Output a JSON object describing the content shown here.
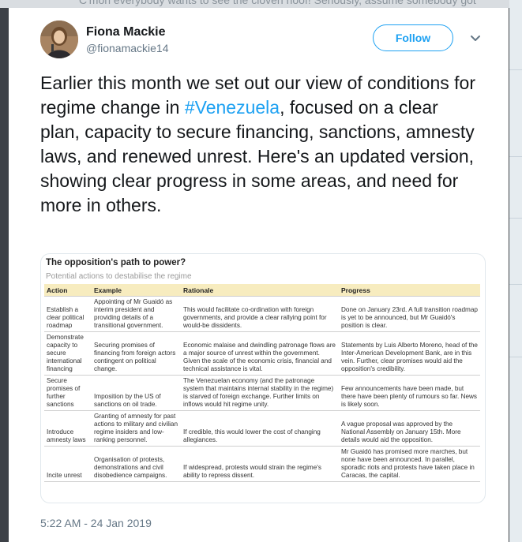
{
  "background_tweet": {
    "text": "C'mon everybody wants to see the cloven hoof! Seriously, assume somebody got"
  },
  "author": {
    "name": "Fiona Mackie",
    "handle": "@fionamackie14"
  },
  "follow_label": "Follow",
  "tweet": {
    "text_before": "Earlier this month we set out our view of conditions for regime change in ",
    "hashtag": "#Venezuela",
    "text_after": ", focused on a clear plan, capacity to secure financing, sanctions, amnesty laws, and renewed unrest. Here's an updated version, showing clear progress in some areas, and need for more in others."
  },
  "table": {
    "title": "The opposition's path to power?",
    "subtitle": "Potential actions to destabilise the regime",
    "headers": [
      "Action",
      "Example",
      "Rationale",
      "Progress"
    ],
    "rows": [
      {
        "action": "Establish a clear political roadmap",
        "example": "Appointing of Mr Guaidó as interim president and providing details of a transitional government.",
        "rationale": "This would facilitate co-ordination with foreign governments, and provide a clear rallying point for would-be dissidents.",
        "progress": "Done on January 23rd. A full transition roadmap is yet to be announced, but Mr Guaidó's position is clear."
      },
      {
        "action": "Demonstrate capacity to secure international financing",
        "example": "Securing promises of financing from foreign actors contingent on political change.",
        "rationale": "Economic malaise and dwindling patronage flows are a major source of unrest within the government. Given the scale of the economic crisis, financial and technical assistance is vital.",
        "progress": "Statements by Luis Alberto Moreno, head of the Inter-American Development Bank, are in this vein. Further, clear promises would aid the opposition's credibility."
      },
      {
        "action": "Secure promises of further sanctions",
        "example": "Imposition by the US of sanctions on oil trade.",
        "rationale": "The Venezuelan economy (and the patronage system that maintains internal stability in the regime) is starved of foreign exchange. Further limits on inflows would hit regime unity.",
        "progress": "Few announcements have been made, but there have been plenty of rumours so far. News is likely soon."
      },
      {
        "action": "Introduce amnesty laws",
        "example": "Granting of amnesty for past actions to military and civilian regime insiders and low-ranking personnel.",
        "rationale": "If credible, this would lower the cost of changing allegiances.",
        "progress": "A vague proposal was approved by the National Assembly on January 15th. More details would aid the opposition."
      },
      {
        "action": "Incite unrest",
        "example": "Organisation of protests, demonstrations and civil disobedience campaigns.",
        "rationale": "If widespread, protests would strain the regime's ability to repress dissent.",
        "progress": "Mr Guaidó has promised more marches, but none have been announced. In parallel, sporadic riots and protests have taken place in Caracas, the capital."
      }
    ]
  },
  "timestamp": "5:22 AM - 24 Jan 2019",
  "icons": {
    "caret": "chevron-down-icon",
    "avatar": "avatar"
  },
  "colors": {
    "accent": "#1da1f2",
    "text": "#14171a",
    "muted": "#657786",
    "table_header": "#f7ecbf"
  }
}
